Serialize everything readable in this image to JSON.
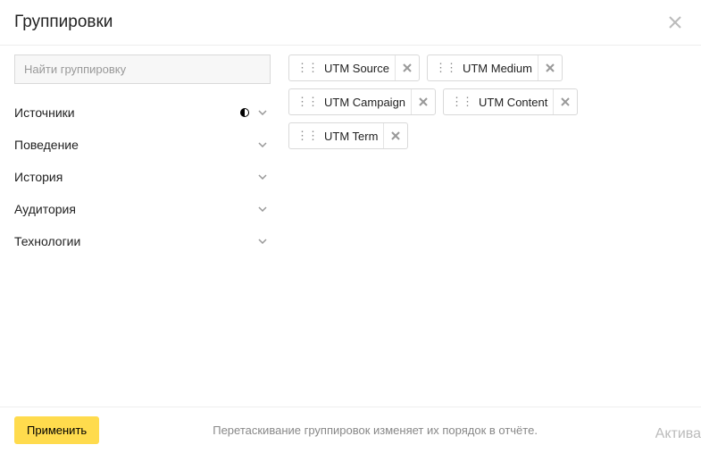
{
  "title": "Группировки",
  "search": {
    "placeholder": "Найти группировку"
  },
  "categories": [
    {
      "label": "Источники",
      "has_indicator": true
    },
    {
      "label": "Поведение",
      "has_indicator": false
    },
    {
      "label": "История",
      "has_indicator": false
    },
    {
      "label": "Аудитория",
      "has_indicator": false
    },
    {
      "label": "Технологии",
      "has_indicator": false
    }
  ],
  "chips": [
    {
      "label": "UTM Source"
    },
    {
      "label": "UTM Medium"
    },
    {
      "label": "UTM Campaign"
    },
    {
      "label": "UTM Content"
    },
    {
      "label": "UTM Term"
    }
  ],
  "footer": {
    "apply_label": "Применить",
    "hint": "Перетаскивание группировок изменяет их порядок в отчёте."
  },
  "watermark": "Актива"
}
